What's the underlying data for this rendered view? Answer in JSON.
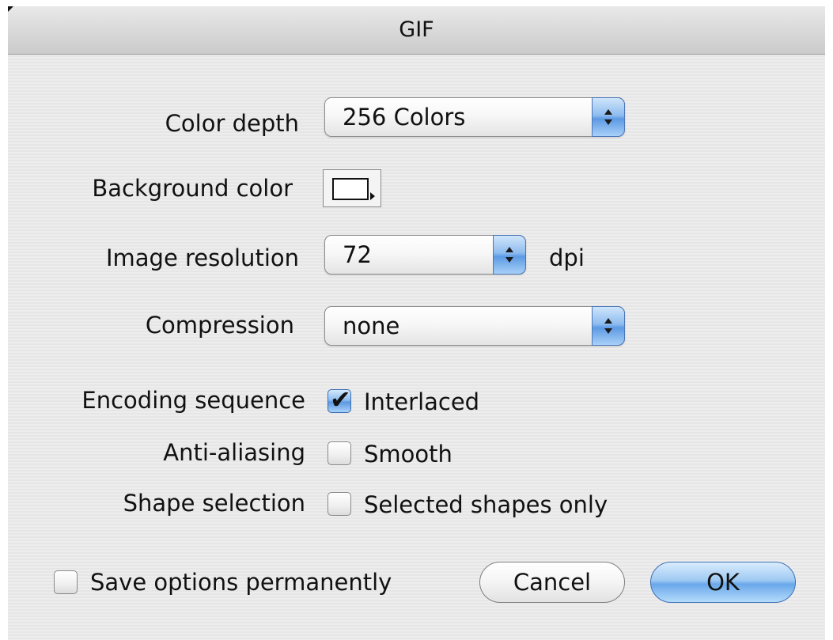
{
  "window": {
    "title": "GIF"
  },
  "fields": {
    "color_depth": {
      "label": "Color depth",
      "value": "256 Colors"
    },
    "background_color": {
      "label": "Background color",
      "color": "#ffffff"
    },
    "image_resolution": {
      "label": "Image resolution",
      "value": "72",
      "unit": "dpi"
    },
    "compression": {
      "label": "Compression",
      "value": "none"
    },
    "encoding_sequence": {
      "label": "Encoding sequence",
      "option": "Interlaced",
      "checked": true
    },
    "anti_aliasing": {
      "label": "Anti-aliasing",
      "option": "Smooth",
      "checked": false
    },
    "shape_selection": {
      "label": "Shape selection",
      "option": "Selected shapes only",
      "checked": false
    }
  },
  "footer": {
    "save_options": {
      "label": "Save options permanently",
      "checked": false
    },
    "cancel_label": "Cancel",
    "ok_label": "OK"
  },
  "icons": {
    "checkmark": "✔",
    "popup_arrows": "up-down-arrows-icon"
  }
}
